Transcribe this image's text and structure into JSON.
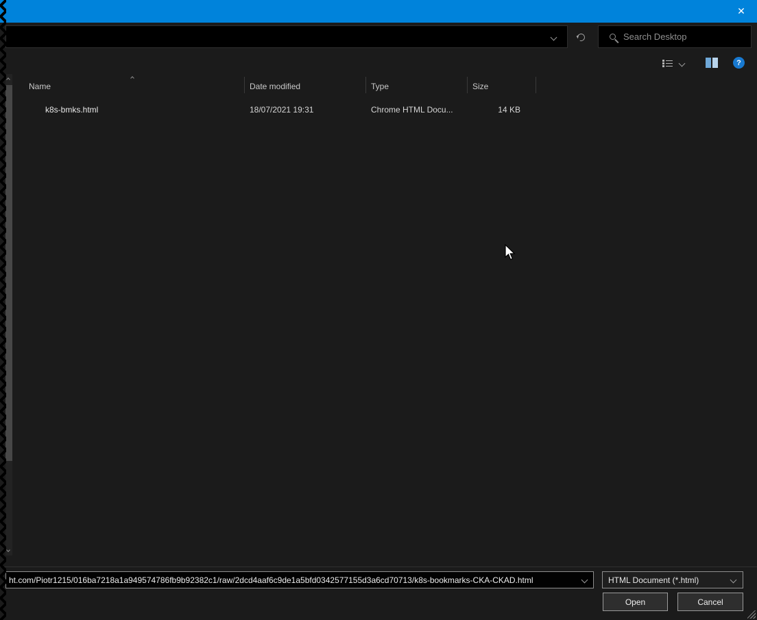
{
  "colors": {
    "titlebar": "#0083db",
    "help": "#1879d0"
  },
  "titlebar": {
    "close_icon": "✕"
  },
  "address_bar": {
    "search_placeholder": "Search Desktop"
  },
  "toolbar": {
    "help_icon": "?"
  },
  "file_list": {
    "columns": {
      "name": "Name",
      "date_modified": "Date modified",
      "type": "Type",
      "size": "Size"
    },
    "rows": [
      {
        "name": "k8s-bmks.html",
        "date_modified": "18/07/2021 19:31",
        "type": "Chrome HTML Docu...",
        "size": "14 KB"
      }
    ]
  },
  "footer": {
    "filename_value": "ht.com/Piotr1215/016ba7218a1a949574786fb9b92382c1/raw/2dcd4aaf6c9de1a5bfd0342577155d3a6cd70713/k8s-bookmarks-CKA-CKAD.html",
    "filetype_value": "HTML Document (*.html)",
    "open_label": "Open",
    "cancel_label": "Cancel"
  }
}
